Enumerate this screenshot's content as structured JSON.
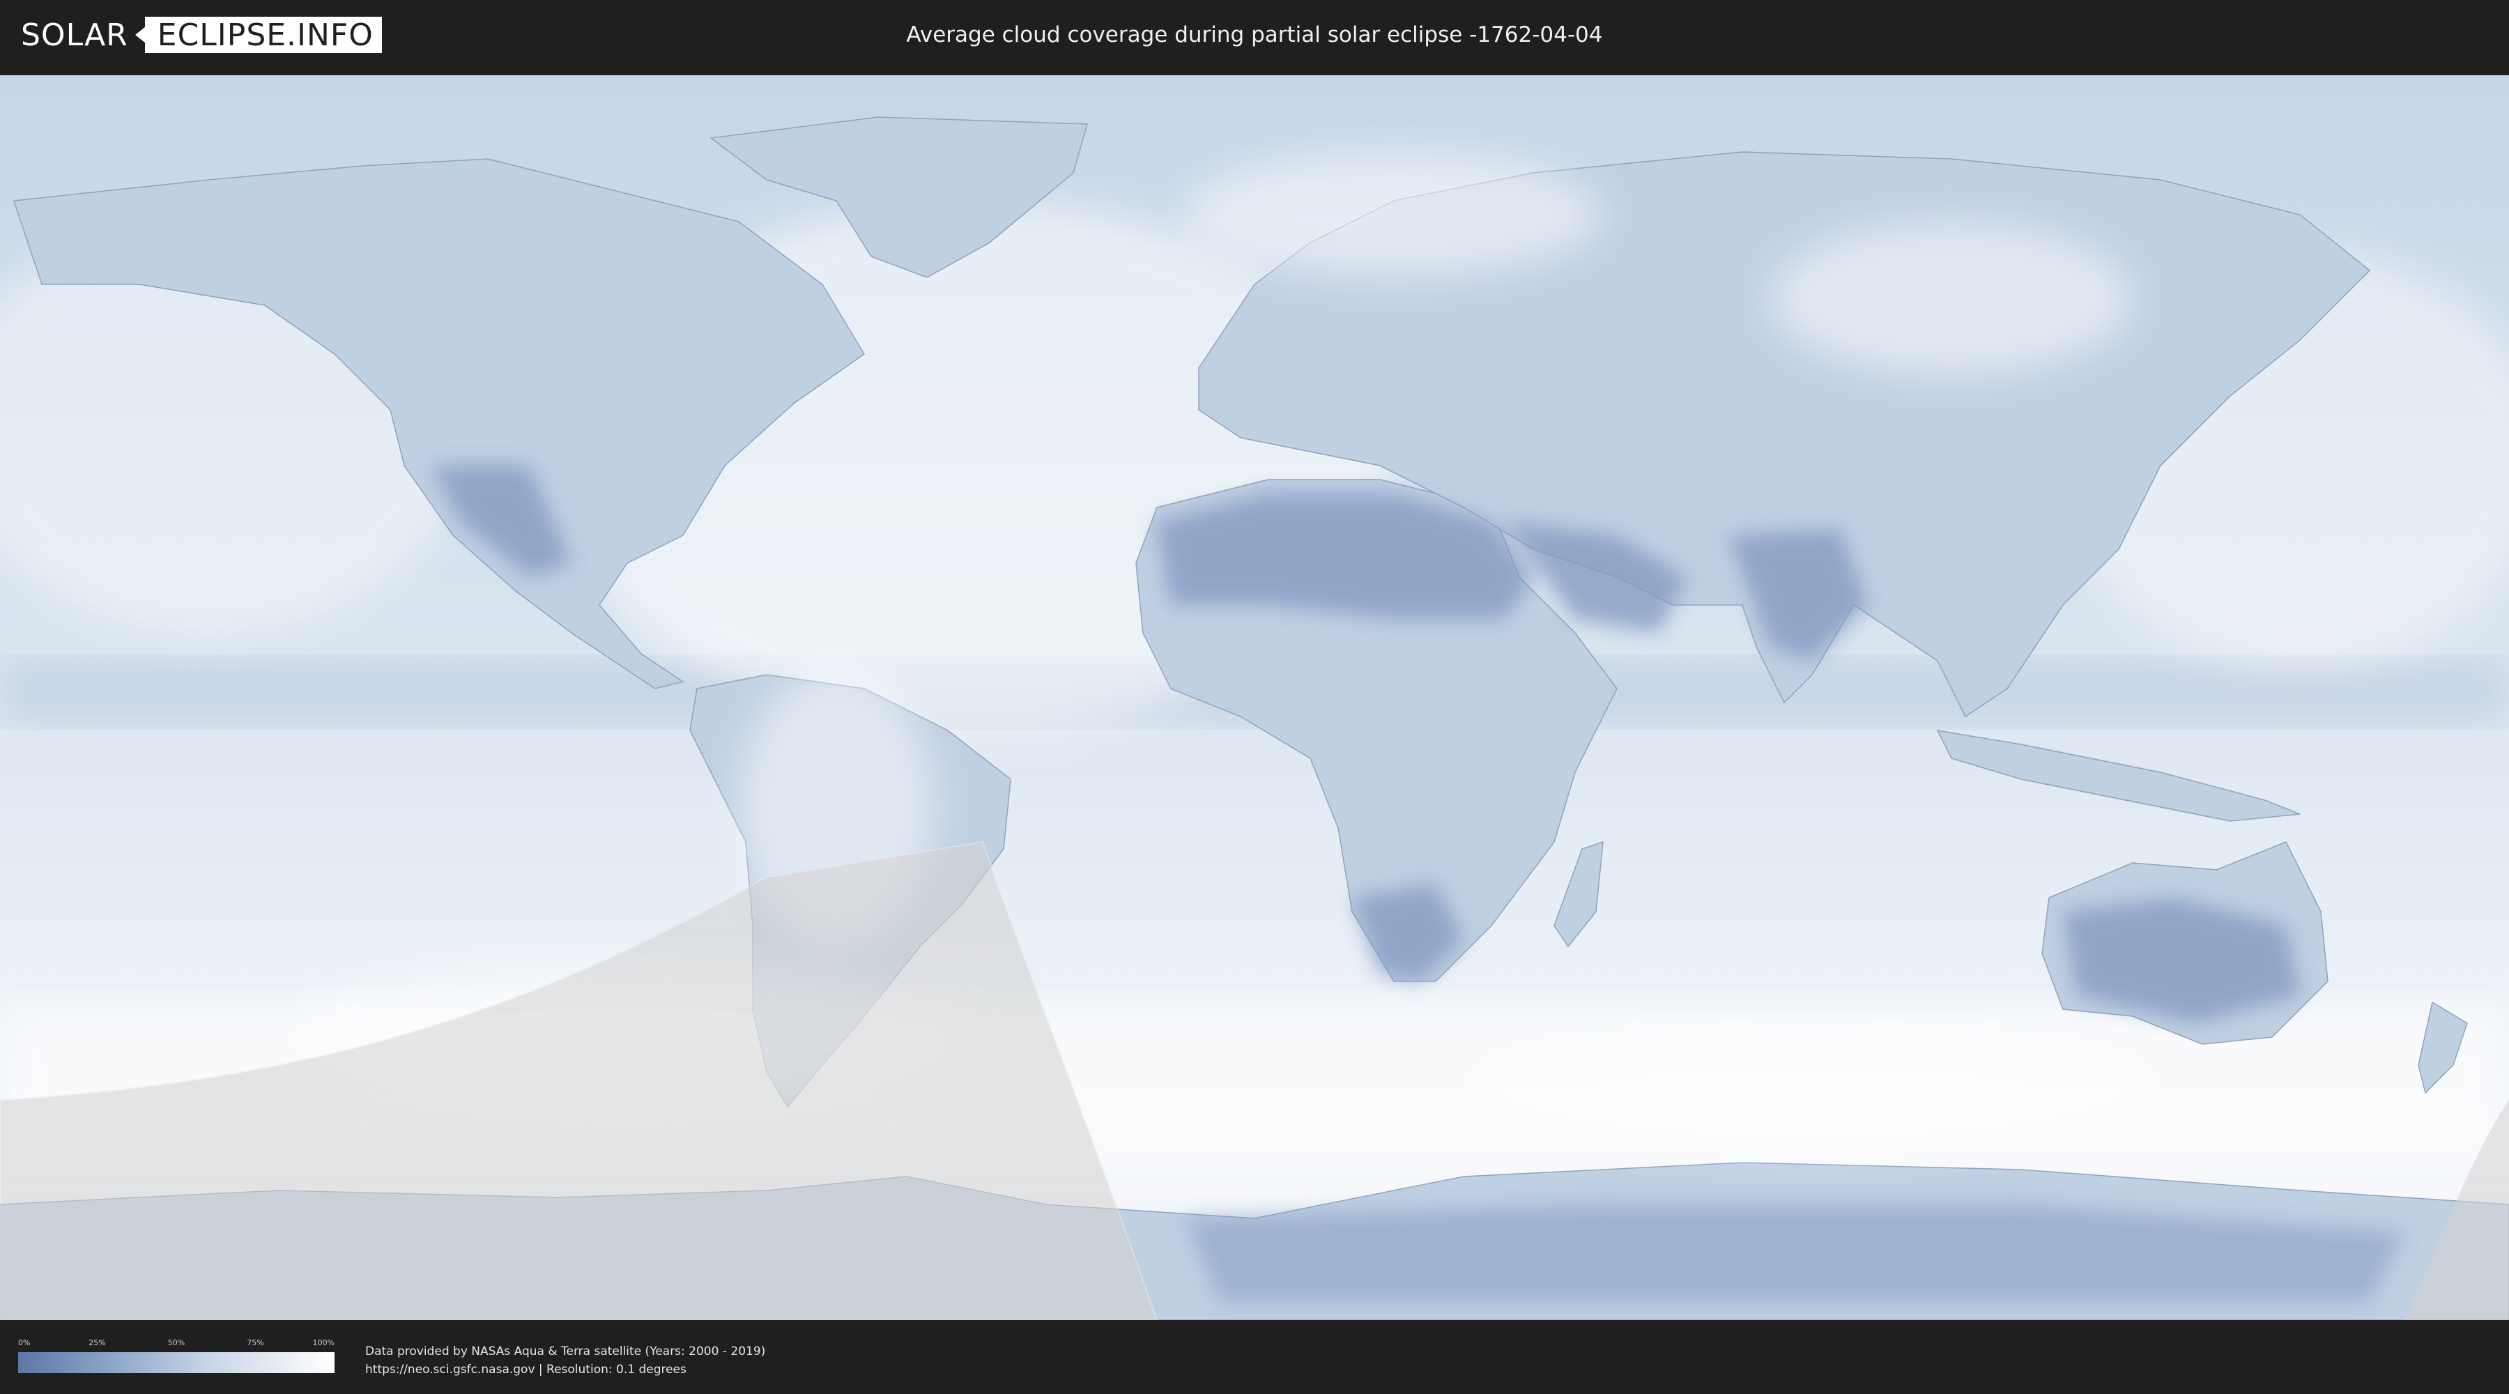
{
  "header": {
    "logo": {
      "part1": "SOLAR",
      "part2": "ECLIPSE.INFO"
    },
    "title": "Average cloud coverage during partial solar eclipse -1762-04-04"
  },
  "legend": {
    "ticks": [
      "0%",
      "25%",
      "50%",
      "75%",
      "100%"
    ],
    "colors": {
      "clear": "#5d77a6",
      "overcast": "#ffffff"
    }
  },
  "credits": {
    "line1": "Data provided by NASAs Aqua & Terra satellite (Years: 2000 - 2019)",
    "line2": "https://neo.sci.gsfc.nasa.gov | Resolution: 0.1 degrees"
  },
  "map": {
    "colors": {
      "ocean": "#d7e3ee",
      "land": "#b9cbe0",
      "dry": "#7f98c0",
      "cloud": "#f4f7fb",
      "eclipse_shade": "#d2d2d2"
    }
  }
}
